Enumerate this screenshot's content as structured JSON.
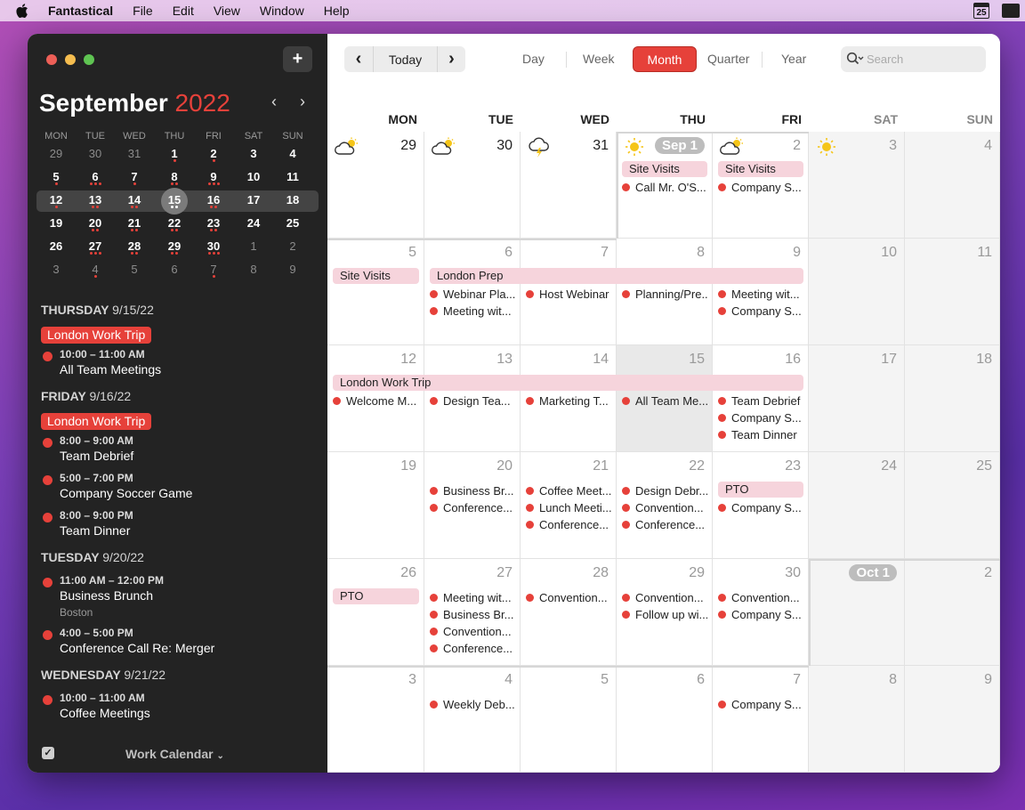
{
  "menubar": {
    "app": "Fantastical",
    "items": [
      "File",
      "Edit",
      "View",
      "Window",
      "Help"
    ],
    "cal_icon_day": "25"
  },
  "sidebar": {
    "add_label": "+",
    "month": "September",
    "year": "2022",
    "prev": "‹",
    "next": "›",
    "weekdays": [
      "MON",
      "TUE",
      "WED",
      "THU",
      "FRI",
      "SAT",
      "SUN"
    ],
    "weeks": [
      [
        "29",
        "30",
        "31",
        "1",
        "2",
        "3",
        "4"
      ],
      [
        "5",
        "6",
        "7",
        "8",
        "9",
        "10",
        "11"
      ],
      [
        "12",
        "13",
        "14",
        "15",
        "16",
        "17",
        "18"
      ],
      [
        "19",
        "20",
        "21",
        "22",
        "23",
        "24",
        "25"
      ],
      [
        "26",
        "27",
        "28",
        "29",
        "30",
        "1",
        "2"
      ],
      [
        "3",
        "4",
        "5",
        "6",
        "7",
        "8",
        "9"
      ]
    ],
    "agenda": [
      {
        "day": "THURSDAY",
        "date": "9/15/22",
        "allday": "London Work Trip",
        "events": [
          {
            "time": "10:00 – 11:00 AM",
            "title": "All Team Meetings"
          }
        ]
      },
      {
        "day": "FRIDAY",
        "date": "9/16/22",
        "allday": "London Work Trip",
        "events": [
          {
            "time": "8:00 – 9:00 AM",
            "title": "Team Debrief"
          },
          {
            "time": "5:00 – 7:00 PM",
            "title": "Company Soccer Game"
          },
          {
            "time": "8:00 – 9:00 PM",
            "title": "Team Dinner"
          }
        ]
      },
      {
        "day": "TUESDAY",
        "date": "9/20/22",
        "events": [
          {
            "time": "11:00 AM – 12:00 PM",
            "title": "Business Brunch",
            "location": "Boston"
          },
          {
            "time": "4:00 – 5:00 PM",
            "title": "Conference Call Re: Merger"
          }
        ]
      },
      {
        "day": "WEDNESDAY",
        "date": "9/21/22",
        "events": [
          {
            "time": "10:00 – 11:00 AM",
            "title": "Coffee Meetings"
          }
        ]
      }
    ],
    "calendar_name": "Work Calendar"
  },
  "toolbar": {
    "prev": "‹",
    "today": "Today",
    "next": "›",
    "views": [
      "Day",
      "Week",
      "Month",
      "Quarter",
      "Year"
    ],
    "active_view": "Month",
    "search_placeholder": "Search"
  },
  "grid": {
    "weekdays": [
      "MON",
      "TUE",
      "WED",
      "THU",
      "FRI",
      "SAT",
      "SUN"
    ],
    "weeks": [
      {
        "days": [
          "29",
          "30",
          "31",
          "Sep 1",
          "2",
          "3",
          "4"
        ],
        "bars": [
          {
            "start": 3,
            "span": 1,
            "label": "Site Visits"
          },
          {
            "start": 4,
            "span": 1,
            "label": "Site Visits"
          }
        ],
        "events": [
          [],
          [],
          [],
          [
            "Call Mr. O'S..."
          ],
          [
            "Company S..."
          ],
          [],
          []
        ]
      },
      {
        "days": [
          "5",
          "6",
          "7",
          "8",
          "9",
          "10",
          "11"
        ],
        "bars": [
          {
            "start": 0,
            "span": 1,
            "label": "Site Visits"
          },
          {
            "start": 1,
            "span": 4,
            "label": "London Prep"
          }
        ],
        "events": [
          [],
          [
            "Webinar Pla...",
            "Meeting wit..."
          ],
          [
            "Host Webinar"
          ],
          [
            "Planning/Pre..."
          ],
          [
            "Meeting wit...",
            "Company S..."
          ],
          [],
          []
        ]
      },
      {
        "days": [
          "12",
          "13",
          "14",
          "15",
          "16",
          "17",
          "18"
        ],
        "bars": [
          {
            "start": 0,
            "span": 5,
            "label": "London Work Trip"
          }
        ],
        "events": [
          [
            "Welcome M..."
          ],
          [
            "Design Tea..."
          ],
          [
            "Marketing T..."
          ],
          [
            "All Team Me..."
          ],
          [
            "Team Debrief",
            "Company S...",
            "Team Dinner"
          ],
          [],
          []
        ]
      },
      {
        "days": [
          "19",
          "20",
          "21",
          "22",
          "23",
          "24",
          "25"
        ],
        "bars": [
          {
            "start": 4,
            "span": 1,
            "label": "PTO"
          }
        ],
        "events": [
          [],
          [
            "Business Br...",
            "Conference..."
          ],
          [
            "Coffee Meet...",
            "Lunch Meeti...",
            "Conference..."
          ],
          [
            "Design Debr...",
            "Convention...",
            "Conference..."
          ],
          [
            "Company S..."
          ],
          [],
          []
        ]
      },
      {
        "days": [
          "26",
          "27",
          "28",
          "29",
          "30",
          "Oct 1",
          "2"
        ],
        "bars": [
          {
            "start": 0,
            "span": 1,
            "label": "PTO"
          }
        ],
        "events": [
          [],
          [
            "Meeting wit...",
            "Business Br...",
            "Convention...",
            "Conference..."
          ],
          [
            "Convention..."
          ],
          [
            "Convention...",
            "Follow up wi..."
          ],
          [
            "Convention...",
            "Company S..."
          ],
          [],
          []
        ]
      },
      {
        "days": [
          "3",
          "4",
          "5",
          "6",
          "7",
          "8",
          "9"
        ],
        "bars": [],
        "events": [
          [],
          [
            "Weekly Deb..."
          ],
          [],
          [],
          [
            "Company S..."
          ],
          [],
          []
        ]
      }
    ]
  }
}
